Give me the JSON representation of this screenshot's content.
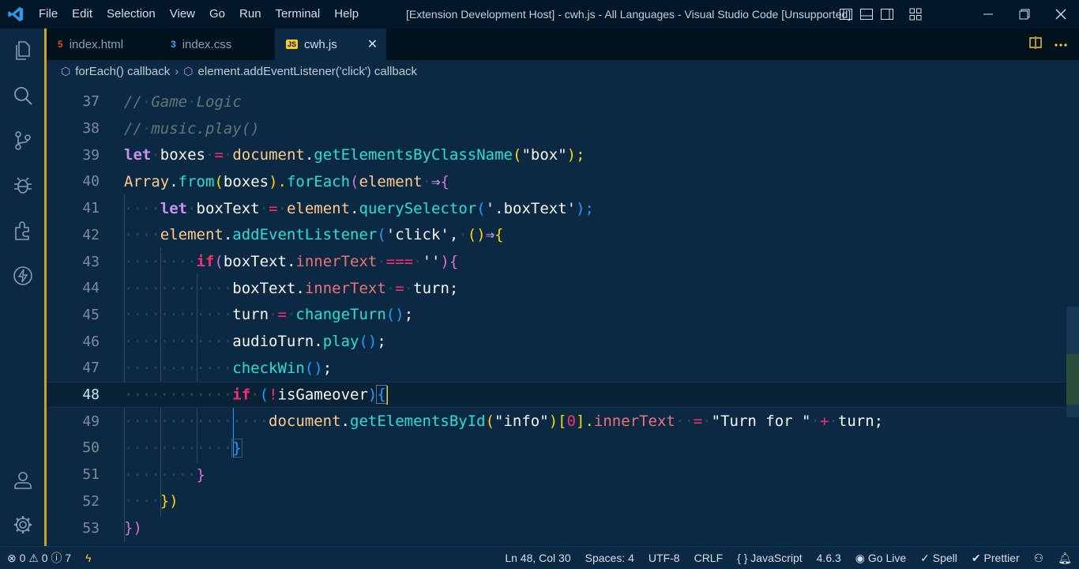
{
  "menu": [
    "File",
    "Edit",
    "Selection",
    "View",
    "Go",
    "Run",
    "Terminal",
    "Help"
  ],
  "window_title": "[Extension Development Host] - cwh.js - All Languages - Visual Studio Code [Unsupported]",
  "tabs": [
    {
      "label": "index.html",
      "icon": "html5-icon",
      "icon_glyph": "5",
      "icon_color": "#e34c26"
    },
    {
      "label": "index.css",
      "icon": "css3-icon",
      "icon_glyph": "3",
      "icon_color": "#42a5f5"
    },
    {
      "label": "cwh.js",
      "icon": "javascript-icon",
      "icon_glyph": "JS",
      "icon_color": "#ffca28",
      "close": "✕"
    }
  ],
  "breadcrumb": [
    {
      "label": "forEach() callback"
    },
    {
      "label": "element.addEventListener('click') callback"
    }
  ],
  "line_numbers": [
    "37",
    "38",
    "39",
    "40",
    "41",
    "42",
    "43",
    "44",
    "45",
    "46",
    "47",
    "48",
    "49",
    "50",
    "51",
    "52",
    "53"
  ],
  "code": {
    "l37": [
      "//",
      "Game",
      "Logic"
    ],
    "l38": [
      "//",
      "music.play()"
    ],
    "l39": [
      "let",
      "boxes",
      "=",
      "document",
      ".",
      "getElementsByClassName",
      "(",
      "\"box\"",
      ");"
    ],
    "l40": [
      "Array",
      ".",
      "from",
      "(",
      "boxes",
      ").",
      "forEach",
      "(",
      "element",
      "⇒",
      "{"
    ],
    "l41": [
      "let",
      "boxText",
      "=",
      "element",
      ".",
      "querySelector",
      "(",
      "'.boxText'",
      ");"
    ],
    "l42": [
      "element",
      ".",
      "addEventListener",
      "(",
      "'click'",
      ",",
      "()",
      "⇒",
      "{"
    ],
    "l43": [
      "if",
      "(",
      "boxText",
      ".",
      "innerText",
      "===",
      "''",
      ")",
      "{"
    ],
    "l44": [
      "boxText",
      ".",
      "innerText",
      "=",
      "turn",
      ";"
    ],
    "l45": [
      "turn",
      "=",
      "changeTurn",
      "()",
      ";"
    ],
    "l46": [
      "audioTurn",
      ".",
      "play",
      "()",
      ";"
    ],
    "l47": [
      "checkWin",
      "()",
      ";"
    ],
    "l48": [
      "if",
      "(",
      "!",
      "isGameover",
      ")",
      "{"
    ],
    "l49": [
      "document",
      ".",
      "getElementsById",
      "(",
      "\"info\"",
      ")[",
      "0",
      "].",
      "innerText",
      "=",
      "\"Turn for \"",
      "+",
      "turn",
      ";"
    ],
    "l50": [
      "}"
    ],
    "l51": [
      "}"
    ],
    "l52": [
      "})"
    ],
    "l53": [
      "})"
    ]
  },
  "status": {
    "errors": "0",
    "warnings": "0",
    "info": "7",
    "position": "Ln 48, Col 30",
    "spaces": "Spaces: 4",
    "encoding": "UTF-8",
    "eol": "CRLF",
    "language": "JavaScript",
    "version": "4.6.3",
    "golive": "Go Live",
    "spell": "Spell",
    "prettier": "Prettier"
  },
  "colors": {
    "accent_border": "#c9a227",
    "background": "#0b2942",
    "titlebar": "#011627"
  }
}
